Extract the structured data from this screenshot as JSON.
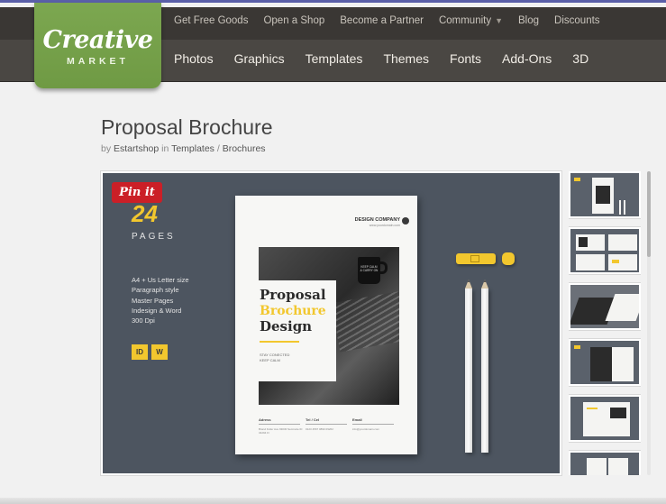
{
  "site": {
    "logo_line1": "Creative",
    "logo_line2": "MARKET"
  },
  "top_nav": {
    "items": [
      {
        "label": "Get Free Goods"
      },
      {
        "label": "Open a Shop"
      },
      {
        "label": "Become a Partner"
      },
      {
        "label": "Community",
        "dropdown": true
      },
      {
        "label": "Blog"
      },
      {
        "label": "Discounts"
      }
    ]
  },
  "main_nav": {
    "items": [
      {
        "label": "Photos"
      },
      {
        "label": "Graphics"
      },
      {
        "label": "Templates"
      },
      {
        "label": "Themes"
      },
      {
        "label": "Fonts"
      },
      {
        "label": "Add-Ons"
      },
      {
        "label": "3D"
      }
    ]
  },
  "product": {
    "title": "Proposal Brochure",
    "by_label": "by",
    "author": "Estartshop",
    "in_label": "in",
    "category": "Templates",
    "separator": "/",
    "subcategory": "Brochures"
  },
  "preview": {
    "pin_label": "Pin it",
    "pages_number": "24",
    "pages_label": "PAGES",
    "specs": [
      "A4 + Us Letter size",
      "Paragraph style",
      "Master Pages",
      "Indesign & Word",
      "300 Dpi"
    ],
    "badges": [
      "ID",
      "W"
    ],
    "brochure": {
      "company": "DESIGN COMPANY",
      "company_sub": "www.yourdomain.com",
      "title1": "Proposal",
      "title2": "Brochure",
      "title3": "Design",
      "stay1": "STAY CONECTED",
      "stay2": "KEEP CALM",
      "mug_text": "KEEP CALM & CARRY ON",
      "footer": [
        {
          "head": "Adress",
          "value": "Brand Fuller Ave 93030 Seminole ID 34294 Fl"
        },
        {
          "head": "Tel / Cel",
          "value": "0123 4567   0890 09262"
        },
        {
          "head": "Email",
          "value": "info@yourdomain.com"
        }
      ]
    }
  },
  "colors": {
    "accent_yellow": "#f2c72e",
    "logo_green": "#7ca750",
    "pin_red": "#cb1f27",
    "nav_dark": "#3a3734"
  },
  "icons": {
    "community_dropdown": "chevron-down-icon"
  }
}
